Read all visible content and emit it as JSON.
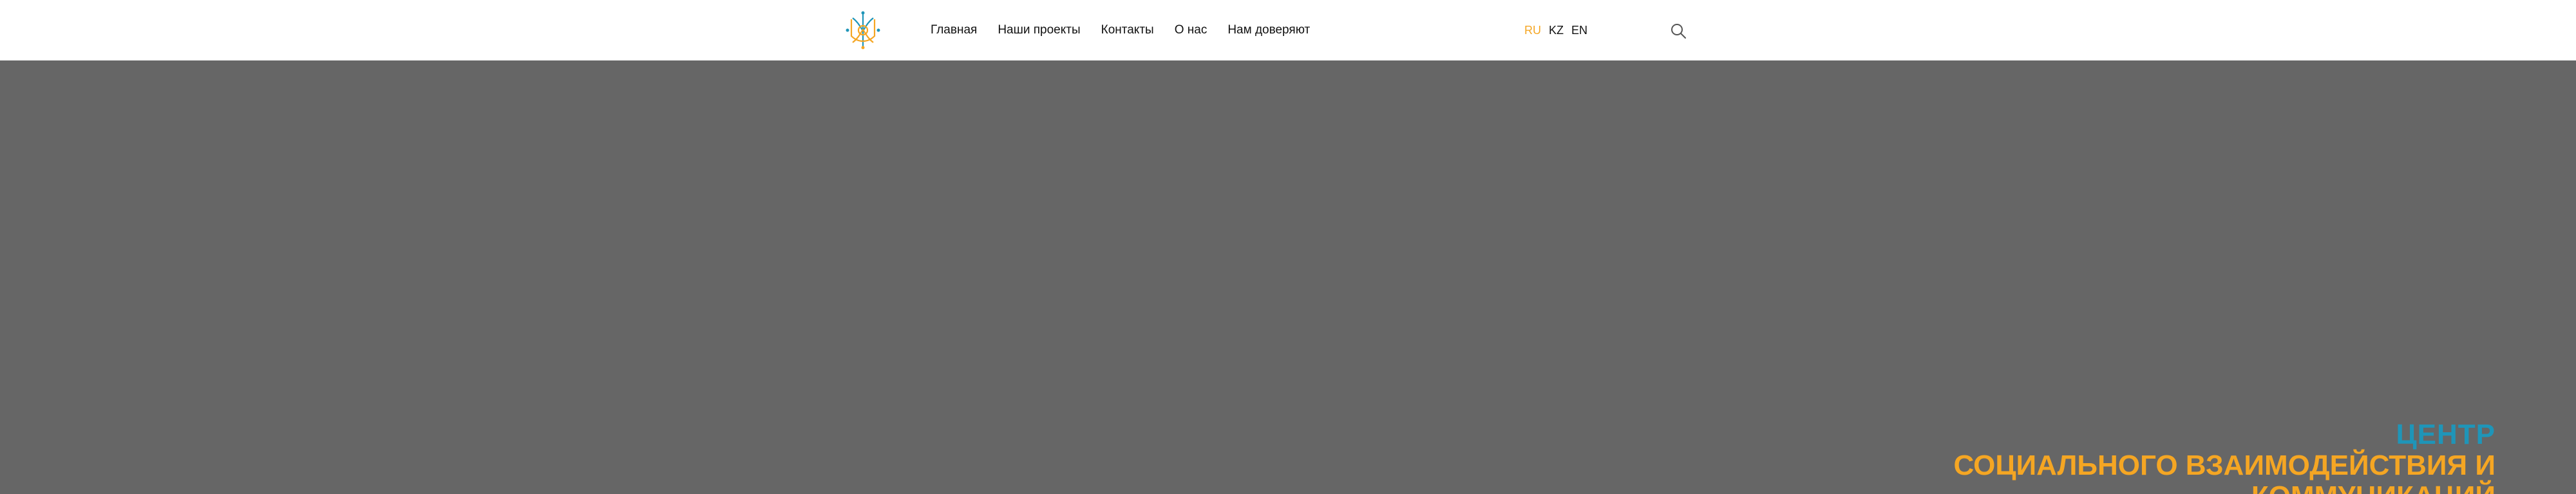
{
  "header": {
    "nav": [
      {
        "label": "Главная"
      },
      {
        "label": "Наши проекты"
      },
      {
        "label": "Контакты"
      },
      {
        "label": "О нас"
      },
      {
        "label": "Нам доверяют"
      }
    ],
    "languages": [
      {
        "label": "RU",
        "active": true
      },
      {
        "label": "KZ",
        "active": false
      },
      {
        "label": "EN",
        "active": false
      }
    ],
    "search_icon": "search-icon",
    "logo_icon": "logo-emblem"
  },
  "hero": {
    "title_line1": "ЦЕНТР",
    "title_line2": "СОЦИАЛЬНОГО ВЗАИМОДЕЙСТВИЯ И",
    "title_line3": "КОММУНИКАЦИЙ",
    "background_color": "#666666"
  },
  "colors": {
    "accent_orange": "#f5a623",
    "accent_teal": "#1f95b8",
    "text_dark": "#111111"
  }
}
